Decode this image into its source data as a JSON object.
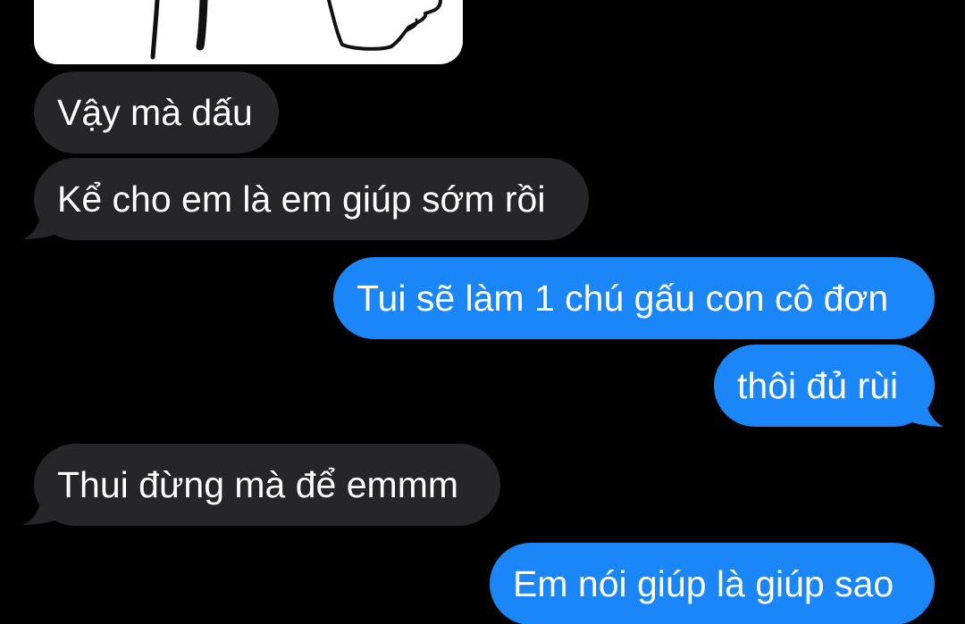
{
  "colors": {
    "background": "#000000",
    "incoming_bubble": "#262628",
    "outgoing_bubble": "#1b86f7",
    "text": "#ffffff"
  },
  "attachment": {
    "kind": "sketch-image"
  },
  "messages": [
    {
      "direction": "incoming",
      "text": "Vậy mà dấu",
      "tail": false
    },
    {
      "direction": "incoming",
      "text": "Kể cho em là em giúp sớm rồi",
      "tail": true
    },
    {
      "direction": "outgoing",
      "text": "Tui sẽ làm 1 chú gấu con cô đơn",
      "tail": false
    },
    {
      "direction": "outgoing",
      "text": "thôi đủ rùi",
      "tail": true
    },
    {
      "direction": "incoming",
      "text": "Thui đừng mà để emmm",
      "tail": true
    },
    {
      "direction": "outgoing",
      "text": "Em nói giúp là giúp sao",
      "tail": false
    }
  ]
}
